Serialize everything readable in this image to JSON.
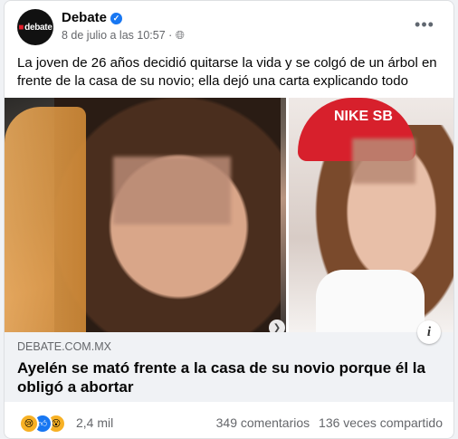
{
  "post": {
    "page_name": "Debate",
    "avatar_text": "debate",
    "timestamp": "8 de julio a las 10:57",
    "separator": "·",
    "body": "La joven de 26 años decidió quitarse la vida y se colgó de un árbol en frente de la casa de su novio; ella dejó una carta explicando todo"
  },
  "link_preview": {
    "domain": "DEBATE.COM.MX",
    "headline": "Ayelén se mató frente a la casa de su novio porque él la obligó a abortar"
  },
  "engagement": {
    "reactions": [
      "sad-emoji",
      "like-icon",
      "wow-emoji"
    ],
    "reaction_count": "2,4 mil",
    "comments": "349 comentarios",
    "shares": "136 veces compartido"
  },
  "images": {
    "right_cap_text": "NIKE SB"
  },
  "icons": {
    "verified": "verified-badge-icon",
    "privacy": "globe-icon",
    "more": "more-options-icon",
    "next": "chevron-right-icon",
    "info": "info-icon"
  },
  "colors": {
    "accent": "#1877f2",
    "cap": "#d7202c",
    "link_box_bg": "#f0f2f5"
  }
}
